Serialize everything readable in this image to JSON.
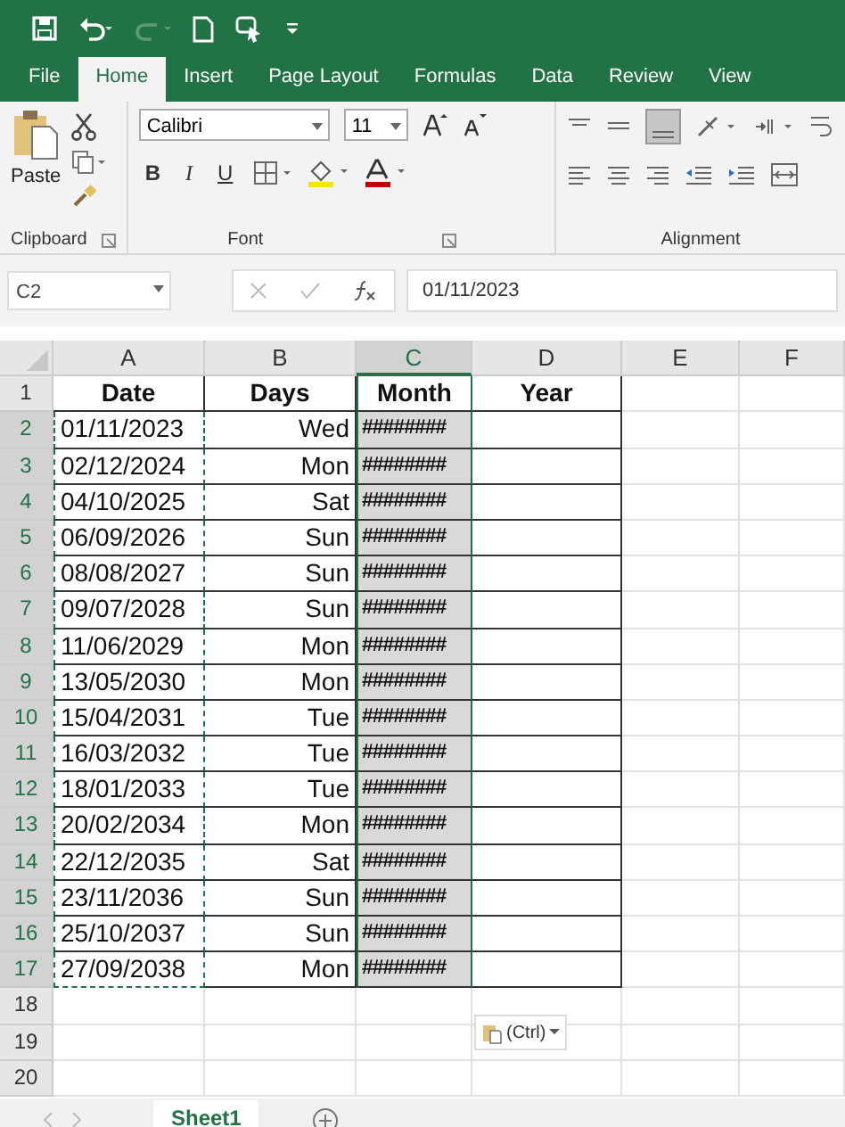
{
  "ribbon_tabs": [
    {
      "label": "File",
      "selected": false
    },
    {
      "label": "Home",
      "selected": true
    },
    {
      "label": "Insert",
      "selected": false
    },
    {
      "label": "Page Layout",
      "selected": false
    },
    {
      "label": "Formulas",
      "selected": false
    },
    {
      "label": "Data",
      "selected": false
    },
    {
      "label": "Review",
      "selected": false
    },
    {
      "label": "View",
      "selected": false
    }
  ],
  "ribbon": {
    "paste": "Paste",
    "font_name": "Calibri",
    "font_size": "11",
    "bold": "B",
    "italic": "I",
    "underline": "U",
    "groups": [
      "Clipboard",
      "Font",
      "Alignment"
    ]
  },
  "formula_bar": {
    "name_box": "C2",
    "formula": "01/11/2023"
  },
  "columns": [
    {
      "label": "A",
      "selected": false,
      "copied": true
    },
    {
      "label": "B",
      "selected": false,
      "copied": false
    },
    {
      "label": "C",
      "selected": true,
      "copied": false
    },
    {
      "label": "D",
      "selected": false,
      "copied": false
    },
    {
      "label": "E",
      "selected": false,
      "copied": false
    },
    {
      "label": "F",
      "selected": false,
      "copied": false
    }
  ],
  "headings": {
    "row": "1",
    "cells": [
      "Date",
      "Days",
      "Month",
      "Year"
    ]
  },
  "rows": [
    {
      "row": "2",
      "date": "01/11/2023",
      "day": "Wed",
      "month": "########"
    },
    {
      "row": "3",
      "date": "02/12/2024",
      "day": "Mon",
      "month": "########"
    },
    {
      "row": "4",
      "date": "04/10/2025",
      "day": "Sat",
      "month": "########"
    },
    {
      "row": "5",
      "date": "06/09/2026",
      "day": "Sun",
      "month": "########"
    },
    {
      "row": "6",
      "date": "08/08/2027",
      "day": "Sun",
      "month": "########"
    },
    {
      "row": "7",
      "date": "09/07/2028",
      "day": "Sun",
      "month": "########"
    },
    {
      "row": "8",
      "date": "11/06/2029",
      "day": "Mon",
      "month": "########"
    },
    {
      "row": "9",
      "date": "13/05/2030",
      "day": "Mon",
      "month": "########"
    },
    {
      "row": "10",
      "date": "15/04/2031",
      "day": "Tue",
      "month": "########"
    },
    {
      "row": "11",
      "date": "16/03/2032",
      "day": "Tue",
      "month": "########"
    },
    {
      "row": "12",
      "date": "18/01/2033",
      "day": "Tue",
      "month": "########"
    },
    {
      "row": "13",
      "date": "20/02/2034",
      "day": "Mon",
      "month": "########"
    },
    {
      "row": "14",
      "date": "22/12/2035",
      "day": "Sat",
      "month": "########"
    },
    {
      "row": "15",
      "date": "23/11/2036",
      "day": "Sun",
      "month": "########"
    },
    {
      "row": "16",
      "date": "25/10/2037",
      "day": "Sun",
      "month": "########"
    },
    {
      "row": "17",
      "date": "27/09/2038",
      "day": "Mon",
      "month": "########"
    }
  ],
  "empty_rows": [
    "18",
    "19",
    "20"
  ],
  "paste_options": "(Ctrl)",
  "sheet_tabs": [
    {
      "label": "Sheet1",
      "selected": true
    }
  ]
}
